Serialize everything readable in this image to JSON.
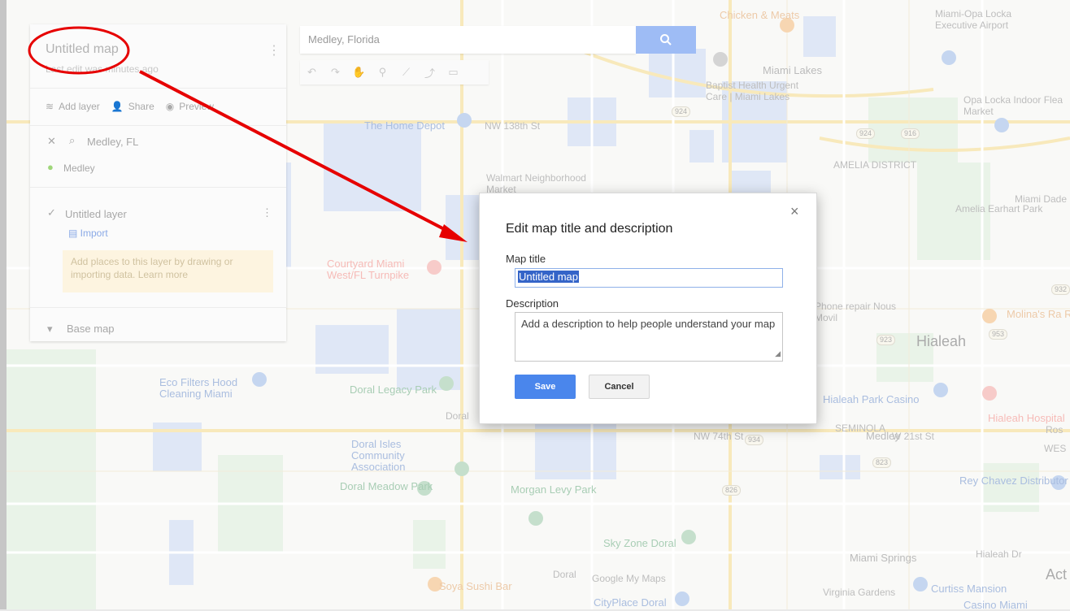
{
  "map_labels": [
    {
      "text": "Chicken & Meats",
      "cls": "orange"
    },
    {
      "text": "Miami Lakes",
      "cls": ""
    },
    {
      "text": "Baptist Health Urgent Care | Miami Lakes",
      "cls": "gray"
    },
    {
      "text": "Miami-Opa Locka Executive Airport",
      "cls": "gray"
    },
    {
      "text": "Opa Locka Indoor Flea Market",
      "cls": "gray"
    },
    {
      "text": "The Home Depot",
      "cls": "blue"
    },
    {
      "text": "NW 138th St",
      "cls": "gray"
    },
    {
      "text": "AMELIA DISTRICT",
      "cls": "gray"
    },
    {
      "text": "Walmart Neighborhood Market",
      "cls": "gray"
    },
    {
      "text": "Amelia Earhart Park",
      "cls": "gray"
    },
    {
      "text": "Miami Dade Nort",
      "cls": "gray"
    },
    {
      "text": "Courtyard Miami West/FL Turnpike",
      "cls": "red"
    },
    {
      "text": "Phone repair Nous Movil",
      "cls": "gray"
    },
    {
      "text": "Molina's Ra Restaurant",
      "cls": "orange"
    },
    {
      "text": "Hialeah",
      "cls": "big"
    },
    {
      "text": "Eco Filters Hood Cleaning Miami",
      "cls": "blue"
    },
    {
      "text": "Doral Legacy Park",
      "cls": "green"
    },
    {
      "text": "Doral",
      "cls": "gray"
    },
    {
      "text": "Hialeah Park Casino",
      "cls": "blue"
    },
    {
      "text": "Hialeah Hospital",
      "cls": "red"
    },
    {
      "text": "SEMINOLA",
      "cls": "gray"
    },
    {
      "text": "W 21st St",
      "cls": "gray"
    },
    {
      "text": "NW 74th St",
      "cls": "gray"
    },
    {
      "text": "Medley",
      "cls": ""
    },
    {
      "text": "Doral Isles Community Association",
      "cls": "blue"
    },
    {
      "text": "Ros",
      "cls": "gray"
    },
    {
      "text": "WES",
      "cls": "gray"
    },
    {
      "text": "Rey Chavez Distributor",
      "cls": "blue"
    },
    {
      "text": "Doral Meadow Park",
      "cls": "green"
    },
    {
      "text": "Morgan Levy Park",
      "cls": "green"
    },
    {
      "text": "Sky Zone Doral",
      "cls": "green"
    },
    {
      "text": "Doral",
      "cls": "gray"
    },
    {
      "text": "Miami Springs",
      "cls": ""
    },
    {
      "text": "Hialeah Dr",
      "cls": "gray"
    },
    {
      "text": "Soya Sushi Bar",
      "cls": "orange"
    },
    {
      "text": "Google My Maps",
      "cls": "gray"
    },
    {
      "text": "CityPlace Doral",
      "cls": "blue"
    },
    {
      "text": "Virginia Gardens",
      "cls": "gray"
    },
    {
      "text": "Curtiss Mansion",
      "cls": "blue"
    },
    {
      "text": "Casino Miami",
      "cls": "blue"
    },
    {
      "text": "Act",
      "cls": "big"
    }
  ],
  "panel": {
    "map_title": "Untitled map",
    "last_edit": "Last edit was minutes ago",
    "add_layer": "Add layer",
    "share": "Share",
    "preview": "Preview",
    "search_result": "Medley, FL",
    "place": "Medley",
    "layer_name": "Untitled layer",
    "import": "Import",
    "layer_hint": "Add places to this layer by drawing or importing data. Learn more",
    "base_map": "Base map"
  },
  "search": {
    "value": "Medley, Florida"
  },
  "dialog": {
    "heading": "Edit map title and description",
    "title_label": "Map title",
    "title_value": "Untitled map",
    "desc_label": "Description",
    "desc_placeholder": "Add a description to help people understand your map",
    "save": "Save",
    "cancel": "Cancel",
    "close": "×"
  },
  "colors": {
    "accent": "#4a86ec",
    "annotation": "#e60000"
  }
}
